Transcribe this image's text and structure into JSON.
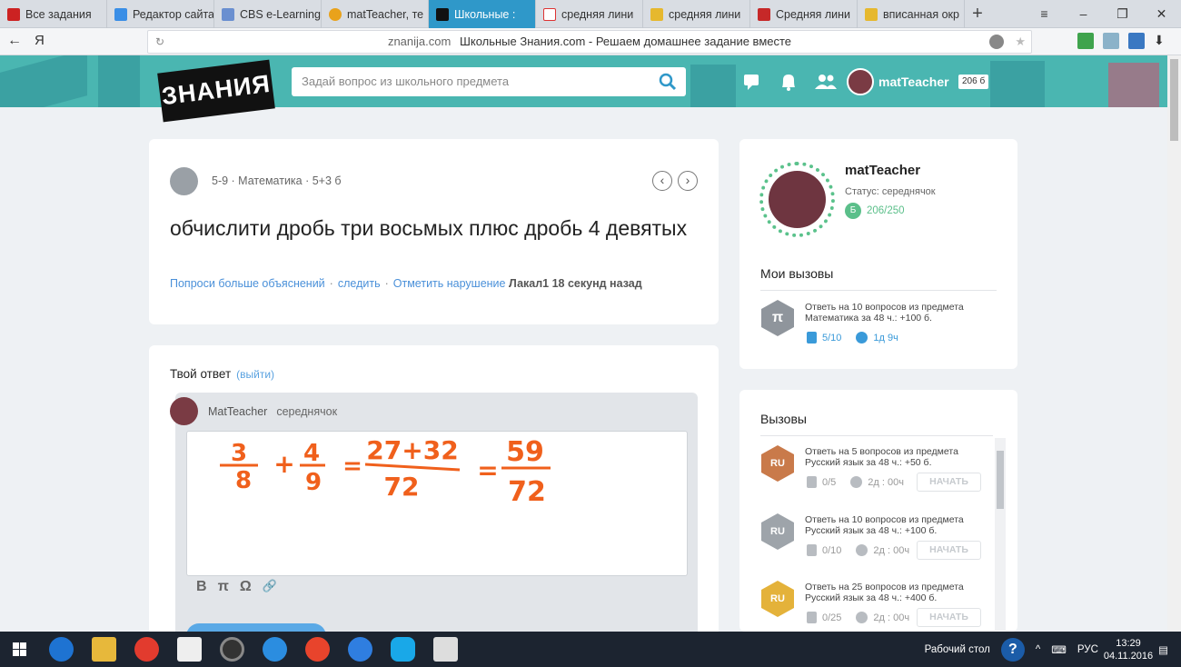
{
  "browser": {
    "tabs": [
      {
        "label": "Все задания",
        "color": "#c22",
        "active": false
      },
      {
        "label": "Редактор сайта",
        "color": "#3a8ee6",
        "active": false
      },
      {
        "label": "CBS e-Learning",
        "color": "#6a8fd0",
        "active": false
      },
      {
        "label": "matTeacher, те",
        "color": "#e9a21b",
        "active": false
      },
      {
        "label": "Школьные :",
        "color": "#111",
        "active": true
      },
      {
        "label": "средняя лини",
        "color": "#d33",
        "active": false
      },
      {
        "label": "средняя лини",
        "color": "#e6b82e",
        "active": false
      },
      {
        "label": "Средняя лини",
        "color": "#c62828",
        "active": false
      },
      {
        "label": "вписанная окр",
        "color": "#e6b82e",
        "active": false
      }
    ],
    "new_tab": "+",
    "window_controls": [
      "≡",
      "–",
      "❐",
      "✕"
    ],
    "back": "←",
    "yandex": "Я",
    "url_domain": "znanija.com",
    "url_title": "Школьные Знания.com - Решаем домашнее задание вместе"
  },
  "header": {
    "logo": "ЗНАНИЯ",
    "search_placeholder": "Задай вопрос из школьного предмета",
    "username": "matTeacher",
    "points": "206 б"
  },
  "question": {
    "meta": "5-9 · Математика · 5+3 б",
    "prev": "‹",
    "next": "›",
    "title": "обчислити дробь три восьмых плюс дробь 4 девятых",
    "link_more": "Попроси больше объяснений",
    "link_follow": "следить",
    "link_report": "Отметить нарушение",
    "author_time": "Лакал1 18 секунд назад"
  },
  "answer": {
    "title": "Твой ответ",
    "exit": "(выйти)",
    "user": "MatTeacher",
    "rank": "середнячок",
    "handwritten": {
      "f1_num": "3",
      "f1_den": "8",
      "plus1": "+",
      "f2_num": "4",
      "f2_den": "9",
      "eq1": "=",
      "f3_num": "27+32",
      "f3_den": "72",
      "eq2": "=",
      "f4_num": "59",
      "f4_den": "72"
    },
    "tools": [
      "B",
      "π",
      "Ω",
      "🔗"
    ]
  },
  "profile": {
    "name": "matTeacher",
    "status": "Статус: середнячок",
    "points": "206/250",
    "badge": "Б"
  },
  "my_challenges": {
    "title": "Мои вызовы",
    "items": [
      {
        "icon": "π",
        "text": "Ответь на 10 вопросов из предмета Математика за 48 ч.: +100 б.",
        "progress": "5/10",
        "time": "1д  9ч",
        "color": "#8f959c"
      }
    ]
  },
  "challenges": {
    "title": "Вызовы",
    "start_label": "НАЧАТЬ",
    "items": [
      {
        "icon": "RU",
        "text": "Ответь на 5 вопросов из предмета Русский язык за 48 ч.: +50 б.",
        "progress": "0/5",
        "time": "2д : 00ч",
        "color": "#c97a4a"
      },
      {
        "icon": "RU",
        "text": "Ответь на 10 вопросов из предмета Русский язык за 48 ч.: +100 б.",
        "progress": "0/10",
        "time": "2д : 00ч",
        "color": "#9ea4aa"
      },
      {
        "icon": "RU",
        "text": "Ответь на 25 вопросов из предмета Русский язык за 48 ч.: +400 б.",
        "progress": "0/25",
        "time": "2д : 00ч",
        "color": "#e4b23a"
      }
    ]
  },
  "taskbar": {
    "desktop": "Рабочий стол",
    "lang": "РУС",
    "time": "13:29",
    "date": "04.11.2016"
  }
}
